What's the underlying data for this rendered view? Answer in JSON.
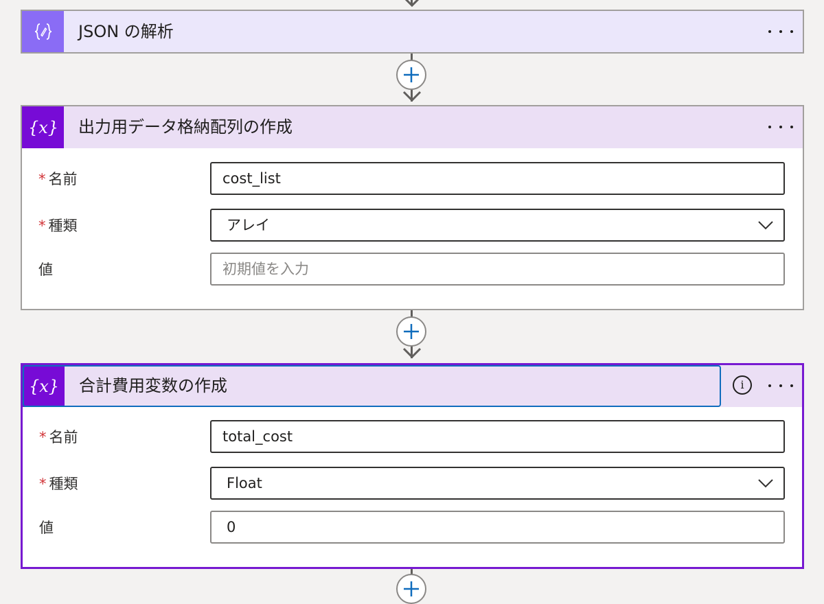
{
  "actions": [
    {
      "title": "JSON の解析",
      "icon": "parse-json-icon",
      "more_icon": "more-options-icon"
    },
    {
      "title": "出力用データ格納配列の作成",
      "icon": "variable-icon",
      "more_icon": "more-options-icon",
      "fields": {
        "name_label": "名前",
        "name_value": "cost_list",
        "type_label": "種類",
        "type_value": "アレイ",
        "value_label": "値",
        "value_placeholder": "初期値を入力",
        "required_mark": "*"
      }
    },
    {
      "title": "合計費用変数の作成",
      "icon": "variable-icon",
      "info_icon": "info-icon",
      "info_glyph": "i",
      "more_icon": "more-options-icon",
      "fields": {
        "name_label": "名前",
        "name_value": "total_cost",
        "type_label": "種類",
        "type_value": "Float",
        "value_label": "値",
        "value_value": "0",
        "required_mark": "*"
      }
    }
  ],
  "connectors": {
    "add_icon": "plus-icon",
    "arrow_icon": "arrow-down-icon"
  },
  "colors": {
    "json_header_bg": "#ebe7fb",
    "json_icon_bg": "#8a6cf5",
    "variable_header_bg": "#ebdff5",
    "variable_icon_bg": "#770bd6",
    "selected_border": "#7719d1",
    "focus_outline": "#0f6cbd",
    "add_plus": "#0f6cbd",
    "required": "#d13438",
    "background": "#f3f2f1"
  }
}
